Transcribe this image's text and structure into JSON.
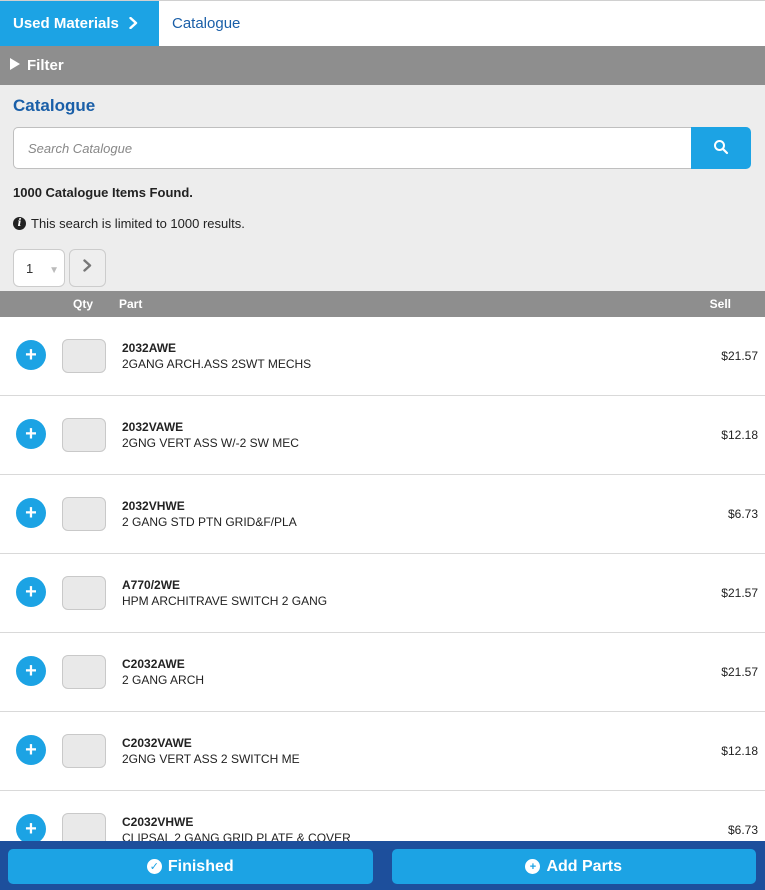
{
  "breadcrumb": {
    "active_label": "Used Materials",
    "current_label": "Catalogue"
  },
  "filter": {
    "label": "Filter"
  },
  "catalogue": {
    "title": "Catalogue",
    "search_placeholder": "Search Catalogue",
    "results_count": "1000 Catalogue Items Found.",
    "limit_note": "This search is limited to 1000 results.",
    "page_value": "1"
  },
  "table": {
    "headers": {
      "qty": "Qty",
      "part": "Part",
      "sell": "Sell"
    },
    "rows": [
      {
        "code": "2032AWE",
        "description": "2GANG ARCH.ASS 2SWT MECHS",
        "sell": "$21.57"
      },
      {
        "code": "2032VAWE",
        "description": "2GNG VERT ASS W/-2 SW MEC",
        "sell": "$12.18"
      },
      {
        "code": "2032VHWE",
        "description": "2 GANG STD PTN GRID&F/PLA",
        "sell": "$6.73"
      },
      {
        "code": "A770/2WE",
        "description": "HPM ARCHITRAVE SWITCH 2 GANG",
        "sell": "$21.57"
      },
      {
        "code": "C2032AWE",
        "description": "2 GANG ARCH",
        "sell": "$21.57"
      },
      {
        "code": "C2032VAWE",
        "description": "2GNG VERT ASS 2 SWITCH ME",
        "sell": "$12.18"
      },
      {
        "code": "C2032VHWE",
        "description": "CLIPSAL 2 GANG GRID PLATE & COVER",
        "sell": "$6.73"
      }
    ]
  },
  "footer": {
    "finished_label": "Finished",
    "add_parts_label": "Add Parts"
  },
  "colors": {
    "accent": "#1ca3e4",
    "title_blue": "#1a5fa8",
    "footer_bg": "#1d4f9c",
    "bar_gray": "#8e8e8e"
  }
}
